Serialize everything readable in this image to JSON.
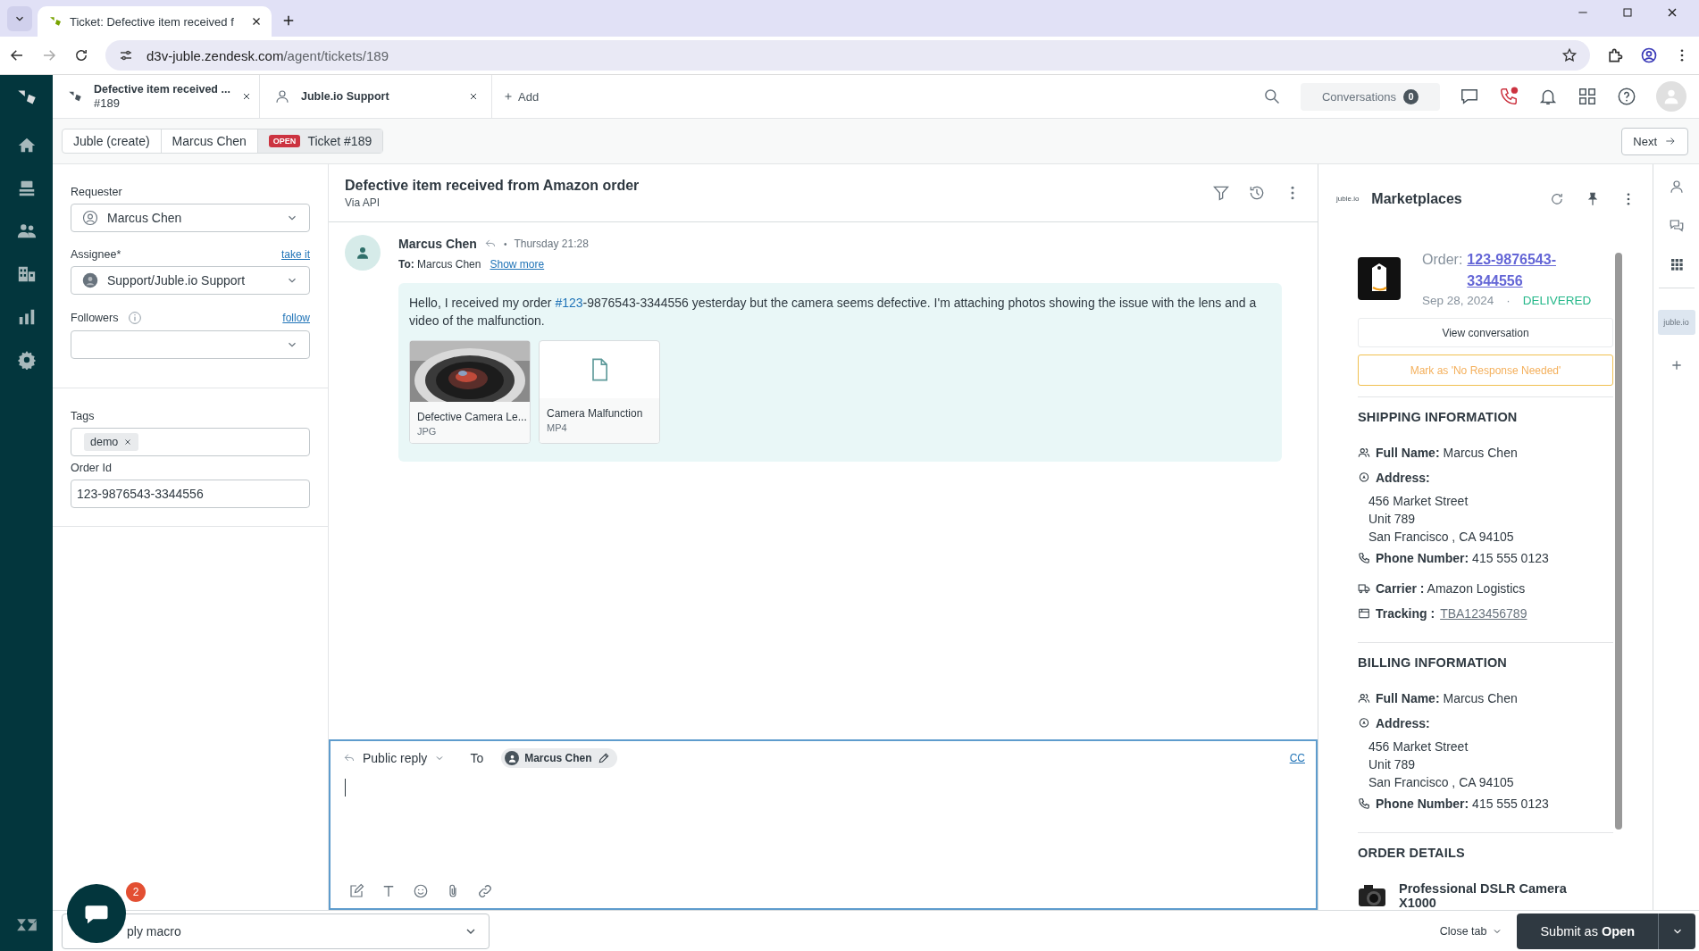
{
  "browser": {
    "tab_title": "Ticket: Defective item received f",
    "url_host": "d3v-juble.zendesk.com",
    "url_path": "/agent/tickets/189"
  },
  "workspace_tabs": [
    {
      "kind": "ticket",
      "title": "Defective item received ...",
      "subtitle": "#189"
    },
    {
      "kind": "user",
      "title": "Juble.io Support"
    }
  ],
  "add_tab": "Add",
  "header": {
    "conversations_label": "Conversations",
    "conversations_count": "0"
  },
  "breadcrumbs": [
    {
      "label": "Juble (create)"
    },
    {
      "label": "Marcus Chen"
    },
    {
      "label": "Ticket #189",
      "status": "OPEN"
    }
  ],
  "next_button": "Next",
  "fields": {
    "requester_label": "Requester",
    "requester": "Marcus Chen",
    "assignee_label": "Assignee*",
    "take_it": "take it",
    "assignee": "Support/Juble.io Support",
    "followers_label": "Followers",
    "follow": "follow",
    "tags_label": "Tags",
    "tags": [
      "demo"
    ],
    "order_id_label": "Order Id",
    "order_id": "123-9876543-3344556"
  },
  "ticket": {
    "subject": "Defective item received from Amazon order",
    "via": "Via API"
  },
  "message": {
    "author": "Marcus Chen",
    "separator": "•",
    "time": "Thursday 21:28",
    "to_label": "To:",
    "to": "Marcus Chen",
    "show_more": "Show more",
    "body": [
      {
        "text": "Hello, I received my order "
      },
      {
        "text": "#123",
        "kind": "link"
      },
      {
        "text": "-9876543-3344556 yesterday but the camera seems defective. I'm attaching photos showing the issue with the lens and a video of the malfunction."
      }
    ],
    "attachments": [
      {
        "name": "Defective Camera Le...",
        "type": "JPG"
      },
      {
        "kind": "file",
        "name": "Camera Malfunction",
        "type": "MP4"
      }
    ]
  },
  "reply": {
    "mode": "Public reply",
    "to_label": "To",
    "recipient": "Marcus Chen",
    "cc": "CC"
  },
  "app": {
    "logo_text": "juble.io",
    "title": "Marketplaces",
    "order_label": "Order:",
    "order_number": "123-9876543-3344556",
    "date": "Sep 28, 2024",
    "separator": "·",
    "status": "DELIVERED",
    "view_button": "View conversation",
    "mark_button": "Mark as 'No Response Needed'",
    "sections": [
      {
        "title": "SHIPPING INFORMATION",
        "rows": [
          {
            "kind": "person",
            "label": "Full Name:",
            "value": "Marcus Chen"
          },
          {
            "kind": "pin",
            "label": "Address:",
            "lines": [
              "456 Market Street",
              "Unit 789",
              "San Francisco , CA 94105"
            ]
          },
          {
            "kind": "phone",
            "label": "Phone Number:",
            "value": "415 555 0123"
          },
          {
            "kind": "truck",
            "label": "Carrier :",
            "value": "Amazon Logistics"
          },
          {
            "kind": "box",
            "label": "Tracking :",
            "value": "TBA123456789",
            "link": true
          }
        ]
      },
      {
        "title": "BILLING INFORMATION",
        "rows": [
          {
            "kind": "person",
            "label": "Full Name:",
            "value": "Marcus Chen"
          },
          {
            "kind": "pin",
            "label": "Address:",
            "lines": [
              "456 Market Street",
              "Unit 789",
              "San Francisco , CA 94105"
            ]
          },
          {
            "kind": "phone",
            "label": "Phone Number:",
            "value": "415 555 0123"
          }
        ]
      },
      {
        "title": "ORDER DETAILS",
        "products": [
          "Professional DSLR Camera X1000"
        ]
      }
    ]
  },
  "rail": {
    "app_label": "juble.io"
  },
  "footer": {
    "macro": "ply macro",
    "close_tab": "Close tab",
    "submit": "Submit as **Open**",
    "chat_badge": "2"
  }
}
